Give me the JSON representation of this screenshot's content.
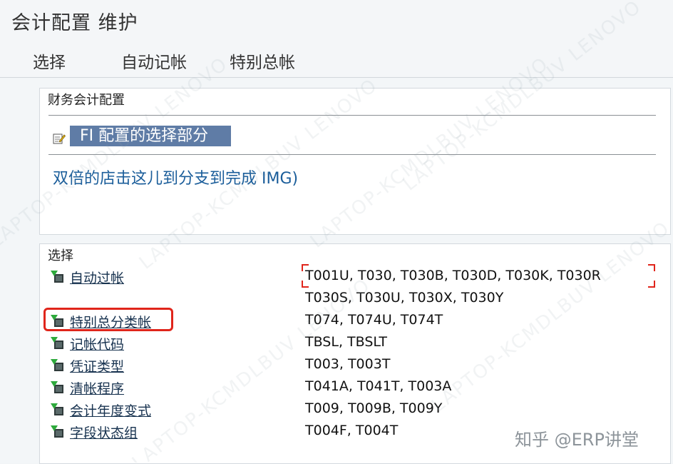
{
  "window": {
    "title": "会计配置 维护"
  },
  "menu": [
    {
      "label": "选择"
    },
    {
      "label": "自动记帐"
    },
    {
      "label": "特别总帐"
    }
  ],
  "config_group": {
    "title": "财务会计配置",
    "banner": "FI 配置的选择部分",
    "hint": "双倍的店击这儿到分支到完成 IMG)"
  },
  "selection_group": {
    "title": "选择",
    "rows": [
      {
        "label": "自动过帐",
        "codes": "T001U, T030,  T030B, T030D, T030K, T030R",
        "codes2": "T030S, T030U, T030X, T030Y"
      },
      {
        "label": "特别总分类帐",
        "codes": "T074,  T074U, T074T"
      },
      {
        "label": "记帐代码",
        "codes": "TBSL,  TBSLT"
      },
      {
        "label": "凭证类型",
        "codes": "T003,  T003T"
      },
      {
        "label": "清帐程序",
        "codes": "T041A, T041T, T003A"
      },
      {
        "label": "会计年度变式",
        "codes": "T009,  T009B, T009Y"
      },
      {
        "label": "字段状态组",
        "codes": "T004F, T004T"
      }
    ]
  },
  "watermark": {
    "text": "LAPTOP-KCMDLBUV  LENOVO"
  },
  "signature": {
    "text": "知乎 @ERP讲堂"
  },
  "colors": {
    "accent": "#5f7ca6",
    "highlight": "#e0251b",
    "link": "#1a5d9a"
  }
}
